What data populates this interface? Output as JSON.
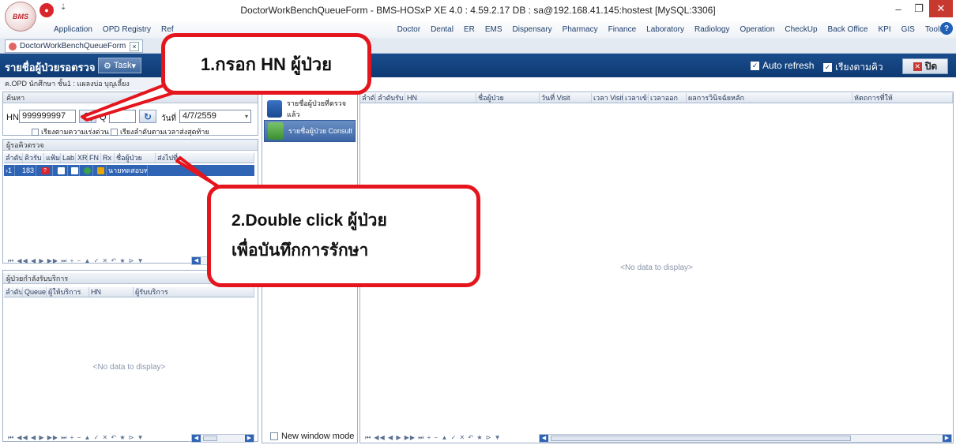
{
  "window": {
    "title": "DoctorWorkBenchQueueForm - BMS-HOSxP XE 4.0 : 4.59.2.17 DB : sa@192.168.41.145:hostest [MySQL:3306]",
    "logo_text": "BMS"
  },
  "menu": {
    "items": [
      "Application",
      "OPD Registry",
      "Ref",
      "Doctor",
      "Dental",
      "ER",
      "EMS",
      "Dispensary",
      "Pharmacy",
      "Finance",
      "Laboratory",
      "Radiology",
      "Operation",
      "CheckUp",
      "Back Office",
      "KPI",
      "GIS",
      "Tools"
    ]
  },
  "doc_tab": {
    "label": "DoctorWorkBenchQueueForm",
    "close": "×"
  },
  "header": {
    "title": "รายชื่อผู้ป่วยรอตรวจ",
    "task_label": "Task",
    "auto_refresh": "Auto refresh",
    "sort_queue": "เรียงตามคิว",
    "close_label": "ปิด"
  },
  "location": "ค.OPD นักศึกษา ชั้น1 : แผลงบ่อ บุญเลี้ยง",
  "search": {
    "section_title": "ค้นหา",
    "hn_label": "HN",
    "hn_value": "999999997",
    "q_label": "Q",
    "date_label": "วันที่",
    "date_value": "4/7/2559",
    "opt_urgent": "เรียงตามความเร่งด่วน",
    "opt_last": "เรียงลำดับตามเวลาส่งสุดท้าย"
  },
  "waiting": {
    "section_title": "ผู้รอคิวตรวจ",
    "columns": [
      "ลำดับ",
      "คิวรับ",
      "แฟ้ม",
      "Lab",
      "XR",
      "FN",
      "Rx",
      "ชื่อผู้ป่วย",
      "ส่งไปที่"
    ],
    "row": {
      "seq": "1",
      "queue": "183",
      "name": "นายทดสอบฟฟร"
    }
  },
  "inservice": {
    "section_title": "ผู้ป่วยกำลังรับบริการ",
    "columns": [
      "ลำดับ",
      "Queue",
      "ผู้ให้บริการ",
      "HN",
      "ผู้รับบริการ"
    ],
    "empty": "<No data to display>"
  },
  "middle": {
    "examined": "รายชื่อผู้ป่วยที่ตรวจแล้ว",
    "consult": "รายชื่อผู้ป่วย Consult",
    "new_window": "New window mode"
  },
  "right_grid": {
    "columns": [
      "ลำดับ",
      "ลำดับรับ",
      "HN",
      "ชื่อผู้ป่วย",
      "วันที่ Visit",
      "เวลา Visit",
      "เวลาเข้า",
      "เวลาออก",
      "ผลการวินิจฉัยหลัก",
      "หัตถการที่ให้"
    ],
    "empty": "<No data to display>"
  },
  "callouts": {
    "step1": "1.กรอก HN ผู้ป่วย",
    "step2_line1": "2.Double click ผู้ป่วย",
    "step2_line2": "เพื่อบันทึกการรักษา"
  },
  "nav_symbols": "⏮ ◀◀ ◀ ▶ ▶▶ ⏭ + − ▲ ✓ ✕ ↶ ★ ⊳ ▼",
  "colors": {
    "header_blue": "#0e3a73",
    "selection_blue": "#2f63b4",
    "callout_red": "#e4151c"
  }
}
